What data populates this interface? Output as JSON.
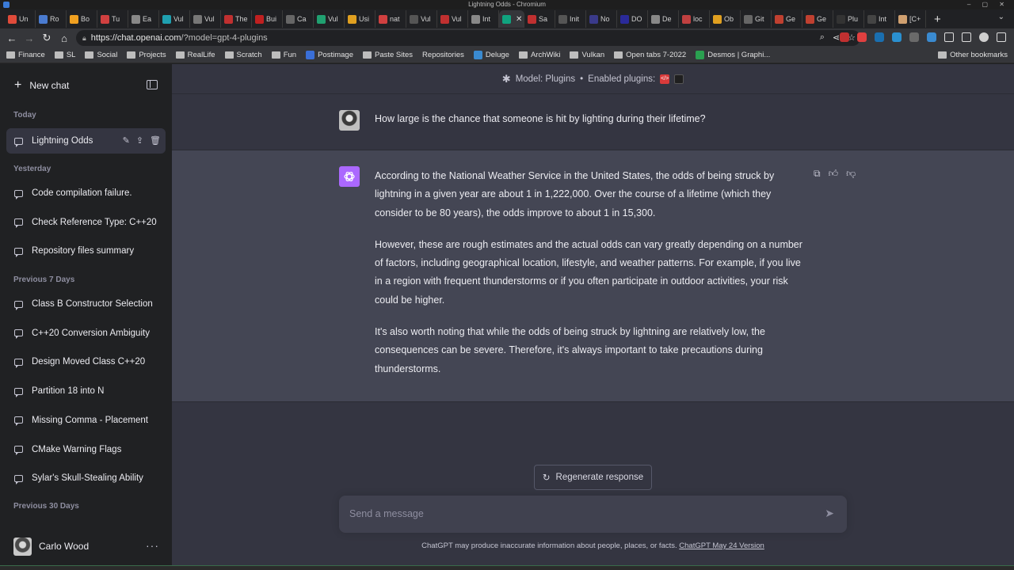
{
  "window": {
    "title": "Lightning Odds - Chromium",
    "controls": "– ▢ ✕"
  },
  "tabs": [
    {
      "label": "Un",
      "color": "#e04b3a"
    },
    {
      "label": "Ro",
      "color": "#4a7bd0"
    },
    {
      "label": "Bo",
      "color": "#f0a020"
    },
    {
      "label": "Tu",
      "color": "#d04040"
    },
    {
      "label": "Ea",
      "color": "#888888"
    },
    {
      "label": "Vul",
      "color": "#1fa0b0"
    },
    {
      "label": "Vul",
      "color": "#777777"
    },
    {
      "label": "The",
      "color": "#c03030"
    },
    {
      "label": "Bui",
      "color": "#c02020"
    },
    {
      "label": "Ca",
      "color": "#666666"
    },
    {
      "label": "Vul",
      "color": "#20a070"
    },
    {
      "label": "Usi",
      "color": "#e0a020"
    },
    {
      "label": "nat",
      "color": "#d04040"
    },
    {
      "label": "Vul",
      "color": "#555555"
    },
    {
      "label": "Vul",
      "color": "#c03030"
    },
    {
      "label": "Int",
      "color": "#888888"
    },
    {
      "label": "",
      "color": "#10a37f"
    },
    {
      "label": "Sa",
      "color": "#c03030"
    },
    {
      "label": "Init",
      "color": "#555555"
    },
    {
      "label": "No",
      "color": "#3a3a8a"
    },
    {
      "label": "DO",
      "color": "#2a2a9a"
    },
    {
      "label": "De",
      "color": "#888888"
    },
    {
      "label": "loc",
      "color": "#c04040"
    },
    {
      "label": "Ob",
      "color": "#e0a020"
    },
    {
      "label": "Git",
      "color": "#666666"
    },
    {
      "label": "Ge",
      "color": "#c04030"
    },
    {
      "label": "Ge",
      "color": "#c04030"
    },
    {
      "label": "Plu",
      "color": "#333333"
    },
    {
      "label": "Int",
      "color": "#444444"
    },
    {
      "label": "[C+",
      "color": "#d0a070"
    }
  ],
  "toolbar": {
    "url_host": "https://chat.openai.com",
    "url_path": "/?model=gpt-4-plugins",
    "ext_colors": [
      "#c03030",
      "#e04040",
      "#1a6fb0",
      "#2a90d0",
      "#6a6a6a",
      "#3a8ad0"
    ]
  },
  "bookmarks": [
    {
      "label": "Finance",
      "kind": "folder"
    },
    {
      "label": "SL",
      "kind": "folder"
    },
    {
      "label": "Social",
      "kind": "folder"
    },
    {
      "label": "Projects",
      "kind": "folder"
    },
    {
      "label": "RealLife",
      "kind": "folder"
    },
    {
      "label": "Scratch",
      "kind": "folder"
    },
    {
      "label": "Fun",
      "kind": "folder"
    },
    {
      "label": "Postimage",
      "kind": "icon",
      "color": "#3a6fd8"
    },
    {
      "label": "Paste Sites",
      "kind": "folder"
    },
    {
      "label": "Repositories",
      "kind": "none"
    },
    {
      "label": "Deluge",
      "kind": "icon",
      "color": "#3a8ad0"
    },
    {
      "label": "ArchWiki",
      "kind": "folder"
    },
    {
      "label": "Vulkan",
      "kind": "folder"
    },
    {
      "label": "Open tabs 7-2022",
      "kind": "folder"
    },
    {
      "label": "Desmos | Graphi...",
      "kind": "icon",
      "color": "#2aa050"
    }
  ],
  "bookmarks_other": "Other bookmarks",
  "sidebar": {
    "new_chat": "New chat",
    "today_label": "Today",
    "active_chat": "Lightning Odds",
    "yesterday_label": "Yesterday",
    "yesterday": [
      "Code compilation failure.",
      "Check Reference Type: C++20",
      "Repository files summary"
    ],
    "prev7_label": "Previous 7 Days",
    "prev7": [
      "Class B Constructor Selection",
      "C++20 Conversion Ambiguity",
      "Design Moved Class C++20",
      "Partition 18 into N",
      "Missing Comma - Placement",
      "CMake Warning Flags",
      "Sylar's Skull-Stealing Ability"
    ],
    "prev30_label": "Previous 30 Days",
    "user_name": "Carlo Wood"
  },
  "main": {
    "model_label": "Model: Plugins",
    "separator": "•",
    "plugins_label": "Enabled plugins:",
    "user_message": "How large is the chance that someone is hit by lighting during their lifetime?",
    "bot_paragraphs": [
      "According to the National Weather Service in the United States, the odds of being struck by lightning in a given year are about 1 in 1,222,000. Over the course of a lifetime (which they consider to be 80 years), the odds improve to about 1 in 15,300.",
      "However, these are rough estimates and the actual odds can vary greatly depending on a number of factors, including geographical location, lifestyle, and weather patterns. For example, if you live in a region with frequent thunderstorms or if you often participate in outdoor activities, your risk could be higher.",
      "It's also worth noting that while the odds of being struck by lightning are relatively low, the consequences can be severe. Therefore, it's always important to take precautions during thunderstorms."
    ],
    "regenerate": "Regenerate response",
    "composer_placeholder": "Send a message",
    "disclaimer": "ChatGPT may produce inaccurate information about people, places, or facts.",
    "version_link": "ChatGPT May 24 Version"
  }
}
